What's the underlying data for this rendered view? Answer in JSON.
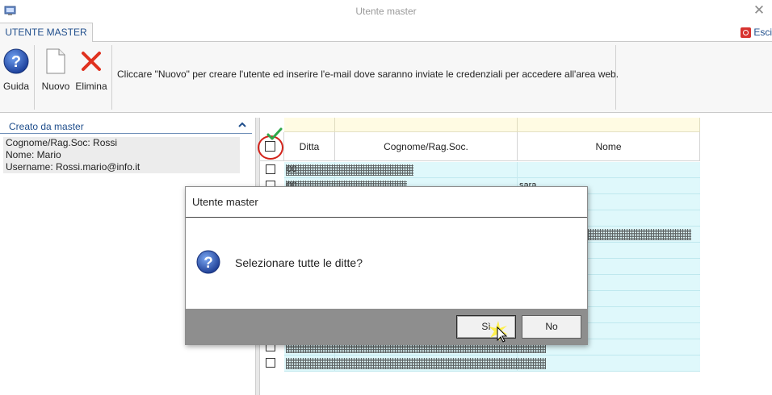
{
  "window": {
    "title": "Utente master"
  },
  "ribbon": {
    "tab_label": "UTENTE MASTER",
    "exit_label": "Esci",
    "buttons": [
      {
        "label": "Guida",
        "icon": "help-icon"
      },
      {
        "label": "Nuovo",
        "icon": "new-document-icon"
      },
      {
        "label": "Elimina",
        "icon": "delete-x-icon"
      }
    ],
    "info_text": "Cliccare \"Nuovo\" per creare l'utente ed inserire l'e-mail dove saranno inviate le credenziali per accedere all'area web."
  },
  "left_panel": {
    "title": "Creato da master",
    "lines": [
      "Cognome/Rag.Soc: Rossi",
      "Nome: Mario",
      "Username: Rossi.mario@info.it"
    ]
  },
  "grid": {
    "columns": [
      "Ditta",
      "Cognome/Rag.Soc.",
      "Nome"
    ],
    "rows": [
      {
        "ditta": "00",
        "nome": ""
      },
      {
        "ditta": "00",
        "nome": "sara"
      },
      {
        "ditta": "",
        "nome": ""
      },
      {
        "ditta": "",
        "nome": ""
      },
      {
        "ditta": "",
        "nome": ""
      },
      {
        "ditta": "",
        "nome": ""
      },
      {
        "ditta": "",
        "nome": ""
      },
      {
        "ditta": "",
        "nome": ""
      },
      {
        "ditta": "",
        "nome": ""
      },
      {
        "ditta": "",
        "nome": ""
      },
      {
        "ditta": "",
        "nome": ""
      },
      {
        "ditta": "",
        "nome": ""
      },
      {
        "ditta": "",
        "nome": ""
      }
    ]
  },
  "dialog": {
    "title": "Utente master",
    "message": "Selezionare tutte le ditte?",
    "yes_label": "Sì",
    "no_label": "No"
  },
  "colors": {
    "accent": "#1f4e8c",
    "row_bg": "#dff8fb",
    "header_band": "#fffbe3",
    "highlight_circle": "#d2221a",
    "dialog_footer": "#8e8e8e"
  }
}
